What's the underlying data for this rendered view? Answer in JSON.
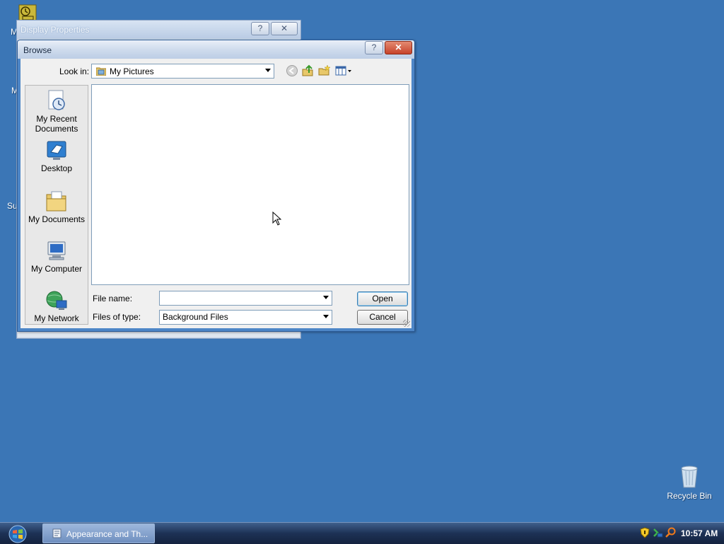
{
  "desktop": {
    "icons": [
      {
        "label": "Recycle Bin",
        "icon": "recycle-bin-icon"
      }
    ],
    "left_edge_fragments": [
      "M",
      "M",
      "Su"
    ]
  },
  "background_window": {
    "title": "Display Properties",
    "help_label": "?",
    "close_label": "✕"
  },
  "dialog": {
    "title": "Browse",
    "help_label": "?",
    "close_label": "✕",
    "look_in_label": "Look in:",
    "look_in_value": "My Pictures",
    "toolbar": [
      "back-icon",
      "up-folder-icon",
      "new-folder-icon",
      "view-menu-icon"
    ],
    "places": [
      {
        "label_line1": "My Recent",
        "label_line2": "Documents",
        "icon": "recent-documents-icon"
      },
      {
        "label_line1": "Desktop",
        "label_line2": "",
        "icon": "desktop-icon"
      },
      {
        "label_line1": "My Documents",
        "label_line2": "",
        "icon": "my-documents-icon"
      },
      {
        "label_line1": "My Computer",
        "label_line2": "",
        "icon": "my-computer-icon"
      },
      {
        "label_line1": "My Network",
        "label_line2": "",
        "icon": "my-network-icon"
      }
    ],
    "file_name_label": "File name:",
    "file_name_value": "",
    "files_of_type_label": "Files of type:",
    "files_of_type_value": "Background Files",
    "open_label": "Open",
    "cancel_label": "Cancel"
  },
  "taskbar": {
    "task_label": "Appearance and Th...",
    "clock": "10:57 AM",
    "tray_icons": [
      "security-shield-icon",
      "network-icon",
      "search-icon"
    ]
  },
  "colors": {
    "desktop": "#3b76b6",
    "dialog_frame": "#4d86c7",
    "dialog_face": "#f0f0f0"
  }
}
